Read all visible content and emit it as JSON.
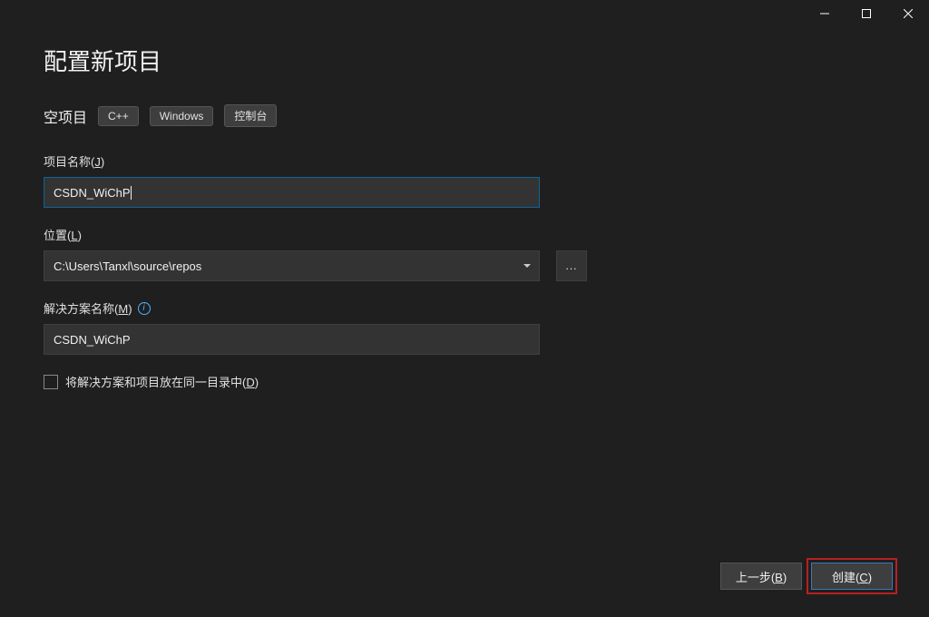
{
  "page": {
    "title": "配置新项目"
  },
  "template": {
    "name": "空项目",
    "tags": [
      "C++",
      "Windows",
      "控制台"
    ]
  },
  "fields": {
    "projectName": {
      "labelPrefix": "项目名称(",
      "hotkey": "J",
      "labelSuffix": ")",
      "value": "CSDN_WiChP"
    },
    "location": {
      "labelPrefix": "位置(",
      "hotkey": "L",
      "labelSuffix": ")",
      "value": "C:\\Users\\Tanxl\\source\\repos",
      "browse": "..."
    },
    "solutionName": {
      "labelPrefix": "解决方案名称(",
      "hotkey": "M",
      "labelSuffix": ")",
      "value": "CSDN_WiChP"
    },
    "sameDir": {
      "labelPrefix": "将解决方案和项目放在同一目录中(",
      "hotkey": "D",
      "labelSuffix": ")"
    }
  },
  "footer": {
    "back": {
      "prefix": "上一步(",
      "hotkey": "B",
      "suffix": ")"
    },
    "create": {
      "prefix": "创建(",
      "hotkey": "C",
      "suffix": ")"
    }
  }
}
